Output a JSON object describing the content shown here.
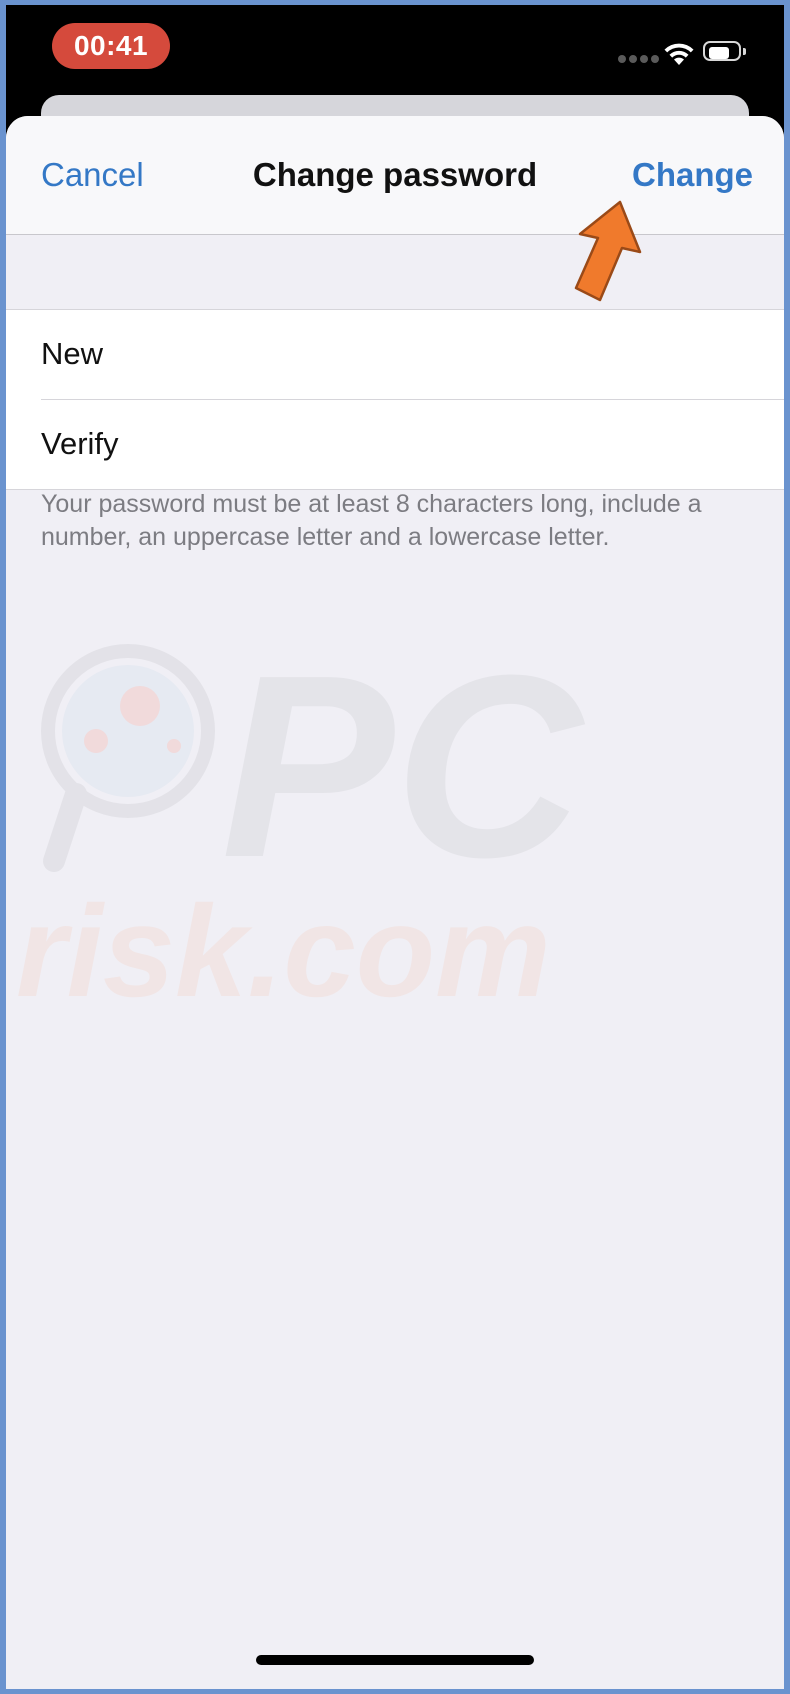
{
  "status_bar": {
    "time": "00:41",
    "time_pill_color": "#d54a3c",
    "icons": [
      "cellular-signal-icon",
      "wifi-icon",
      "battery-icon"
    ]
  },
  "nav": {
    "cancel_label": "Cancel",
    "title": "Change password",
    "change_label": "Change",
    "accent_color": "#3478c6"
  },
  "form": {
    "fields": [
      {
        "label": "New",
        "value": ""
      },
      {
        "label": "Verify",
        "value": ""
      }
    ],
    "hint": "Your password must be at least 8 characters long, include a number, an uppercase letter and a lowercase letter."
  },
  "watermark": {
    "line1": "PC",
    "line2": "risk.com"
  },
  "annotation": {
    "arrow_color": "#f07a2c",
    "points_to": "change-button"
  }
}
